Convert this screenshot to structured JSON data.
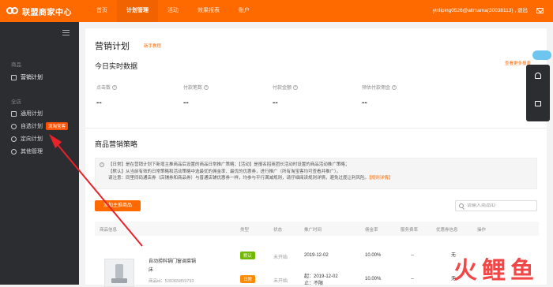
{
  "app": {
    "brand": "联盟商家中心"
  },
  "topnav": {
    "items": [
      "首页",
      "计划管理",
      "活动",
      "效果报表",
      "账户"
    ],
    "active": "计划管理"
  },
  "account": {
    "text": "yinliping0526@alimama(30038113) , 退出"
  },
  "sidebar": {
    "group1": "商品",
    "item_marketing": "营销计划",
    "group2": "全店",
    "item_general": "通用计划",
    "item_custom": "自选计划",
    "item_custom_tag": "流淘宝客",
    "item_targeted": "定向计划",
    "item_other": "其他管理"
  },
  "main": {
    "title": "营销计划",
    "help_link": "新手教程",
    "realtime_title": "今日实时数据",
    "report_link": "查看更多报表",
    "stats": [
      {
        "label": "点击数",
        "value": "--"
      },
      {
        "label": "付款笔数",
        "value": "--"
      },
      {
        "label": "付款金额",
        "value": "--"
      },
      {
        "label": "预估付款佣金",
        "value": "--"
      }
    ],
    "strategy_title": "商品营销策略",
    "notice_line1": "【日常】是在营销计划下新增主推商品后设置的商品日常推广策略；【活动】是报名招商团长活动时设置的商品活动推广策略；",
    "notice_line2": "【默认】从当前有效的日常策略和活动策略中选最优的佣金率、最优的优惠券，进行推广（所有淘宝客均可查看并推广）。",
    "notice_line3_a": "请注意：同里同码通店券（店铺券和商品券）与普通店铺优惠券一样，均参与平行满减规则，请仔细阅读规则详情，避免过度让利风险。",
    "notice_line3_b": "【规则详情】",
    "add_button": "添加主推商品",
    "search_placeholder": "请输入商品ID",
    "columns": [
      "商品信息",
      "类型",
      "状态",
      "推广时间",
      "佣金率",
      "服务费率",
      "优惠券信息",
      "操作"
    ],
    "rows": [
      {
        "name": "自动捞料锅门窗调菜锅",
        "name2": "床",
        "id": "商品id：539365859793",
        "type": "默认",
        "status": "未开始",
        "time": "2019-12-02",
        "rate": "10.00%",
        "fee": "--",
        "coupon": "无"
      },
      {
        "type": "日常",
        "status": "未开始",
        "time": "起：2019-12-02",
        "time2": "止：不限",
        "rate": "10.00%",
        "fee": "--",
        "coupon": "无"
      }
    ]
  },
  "watermark": "火鲤鱼"
}
